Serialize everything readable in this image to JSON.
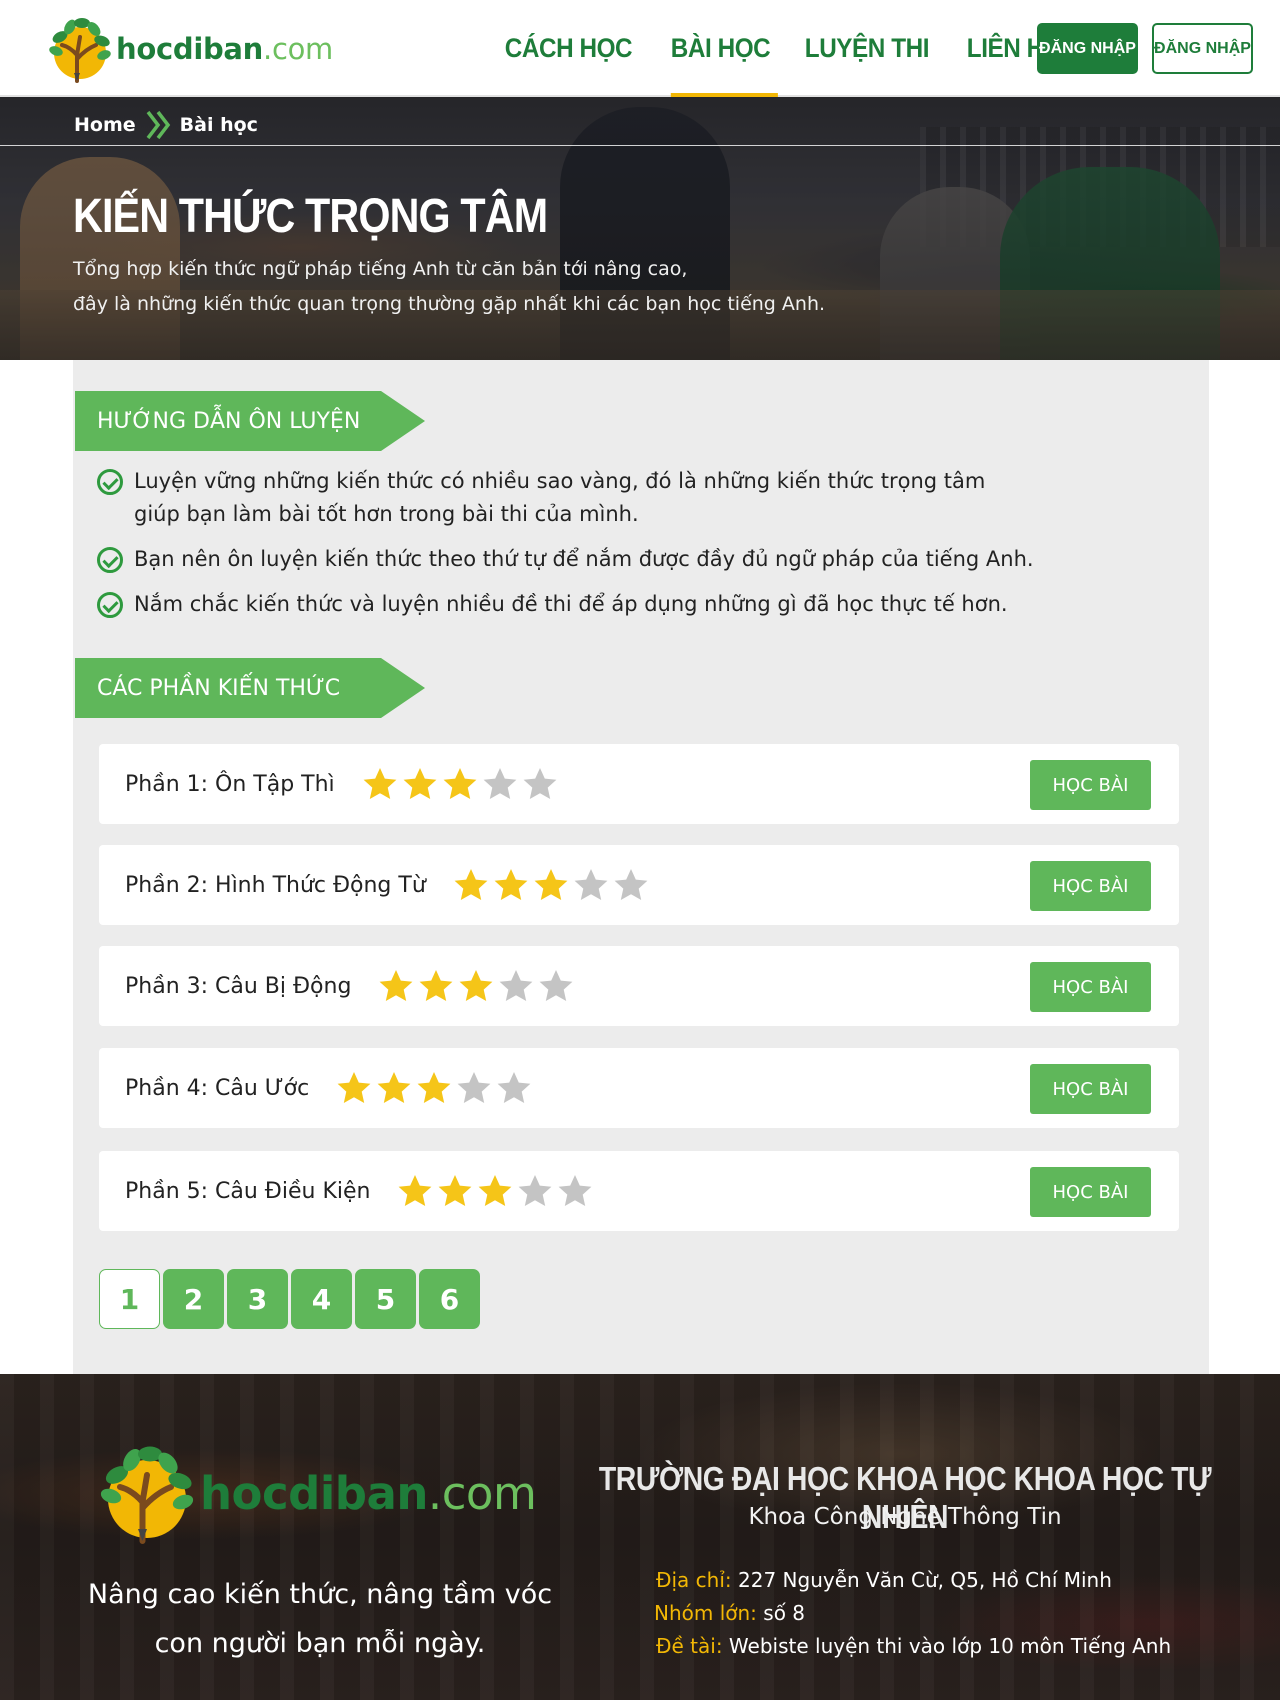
{
  "brand": {
    "name": "hocdiban",
    "domain": ".com",
    "accent": "#1e7d3a",
    "light_accent": "#5fb75a",
    "highlight": "#f2b705"
  },
  "nav": {
    "items": [
      {
        "label": "CÁCH HỌC",
        "active": false
      },
      {
        "label": "BÀI HỌC",
        "active": true
      },
      {
        "label": "LUYỆN THI",
        "active": false
      },
      {
        "label": "LIÊN HỆ",
        "active": false
      }
    ],
    "login_solid": "ĐĂNG NHẬP",
    "login_outline": "ĐĂNG NHẬP"
  },
  "breadcrumb": {
    "home": "Home",
    "current": "Bài học"
  },
  "hero": {
    "title": "KIẾN THỨC TRỌNG TÂM",
    "desc_line1": "Tổng hợp kiến thức ngữ pháp tiếng Anh từ căn bản tới nâng cao,",
    "desc_line2": "đây là những kiến thức quan trọng thường gặp nhất khi các bạn học tiếng Anh."
  },
  "guide": {
    "heading": "HƯỚNG DẪN ÔN LUYỆN",
    "items": [
      "Luyện vững những kiến thức có nhiều sao vàng, đó là những kiến thức trọng tâm giúp bạn làm bài tốt hơn trong bài thi của mình.",
      "Bạn nên ôn luyện kiến thức theo thứ tự để nắm được đầy đủ ngữ pháp của tiếng Anh.",
      "Nắm chắc kiến thức và luyện nhiều đề thi để áp dụng những gì đã học thực tế hơn."
    ]
  },
  "sections": {
    "heading": "CÁC PHẦN KIẾN THỨC",
    "button_label": "HỌC BÀI",
    "lessons": [
      {
        "title": "Phần 1: Ôn Tập Thì",
        "stars": 3,
        "max_stars": 5
      },
      {
        "title": "Phần 2: Hình Thức Động Từ",
        "stars": 3,
        "max_stars": 5
      },
      {
        "title": "Phần 3: Câu Bị Động",
        "stars": 3,
        "max_stars": 5
      },
      {
        "title": "Phần 4: Câu Ước",
        "stars": 3,
        "max_stars": 5
      },
      {
        "title": "Phần 5: Câu Điều Kiện",
        "stars": 3,
        "max_stars": 5
      }
    ],
    "star_on": "#f5c518",
    "star_off": "#c4c4c4"
  },
  "pagination": {
    "pages": [
      "1",
      "2",
      "3",
      "4",
      "5",
      "6"
    ],
    "current": "1"
  },
  "footer": {
    "slogan_line1": "Nâng cao kiến thức, nâng tầm vóc",
    "slogan_line2": "con người bạn mỗi ngày.",
    "school": "TRƯỜNG ĐẠI HỌC KHOA HỌC KHOA HỌC TỰ NHIÊN",
    "faculty": "Khoa Công Nghệ Thông Tin",
    "address_label": "Địa chỉ:",
    "address": "227 Nguyễn Văn Cừ, Q5, Hồ Chí Minh",
    "group_label": "Nhóm lớn:",
    "group": "số 8",
    "topic_label": "Đề tài:",
    "topic": "Webiste luyện thi vào lớp 10 môn Tiếng Anh"
  }
}
